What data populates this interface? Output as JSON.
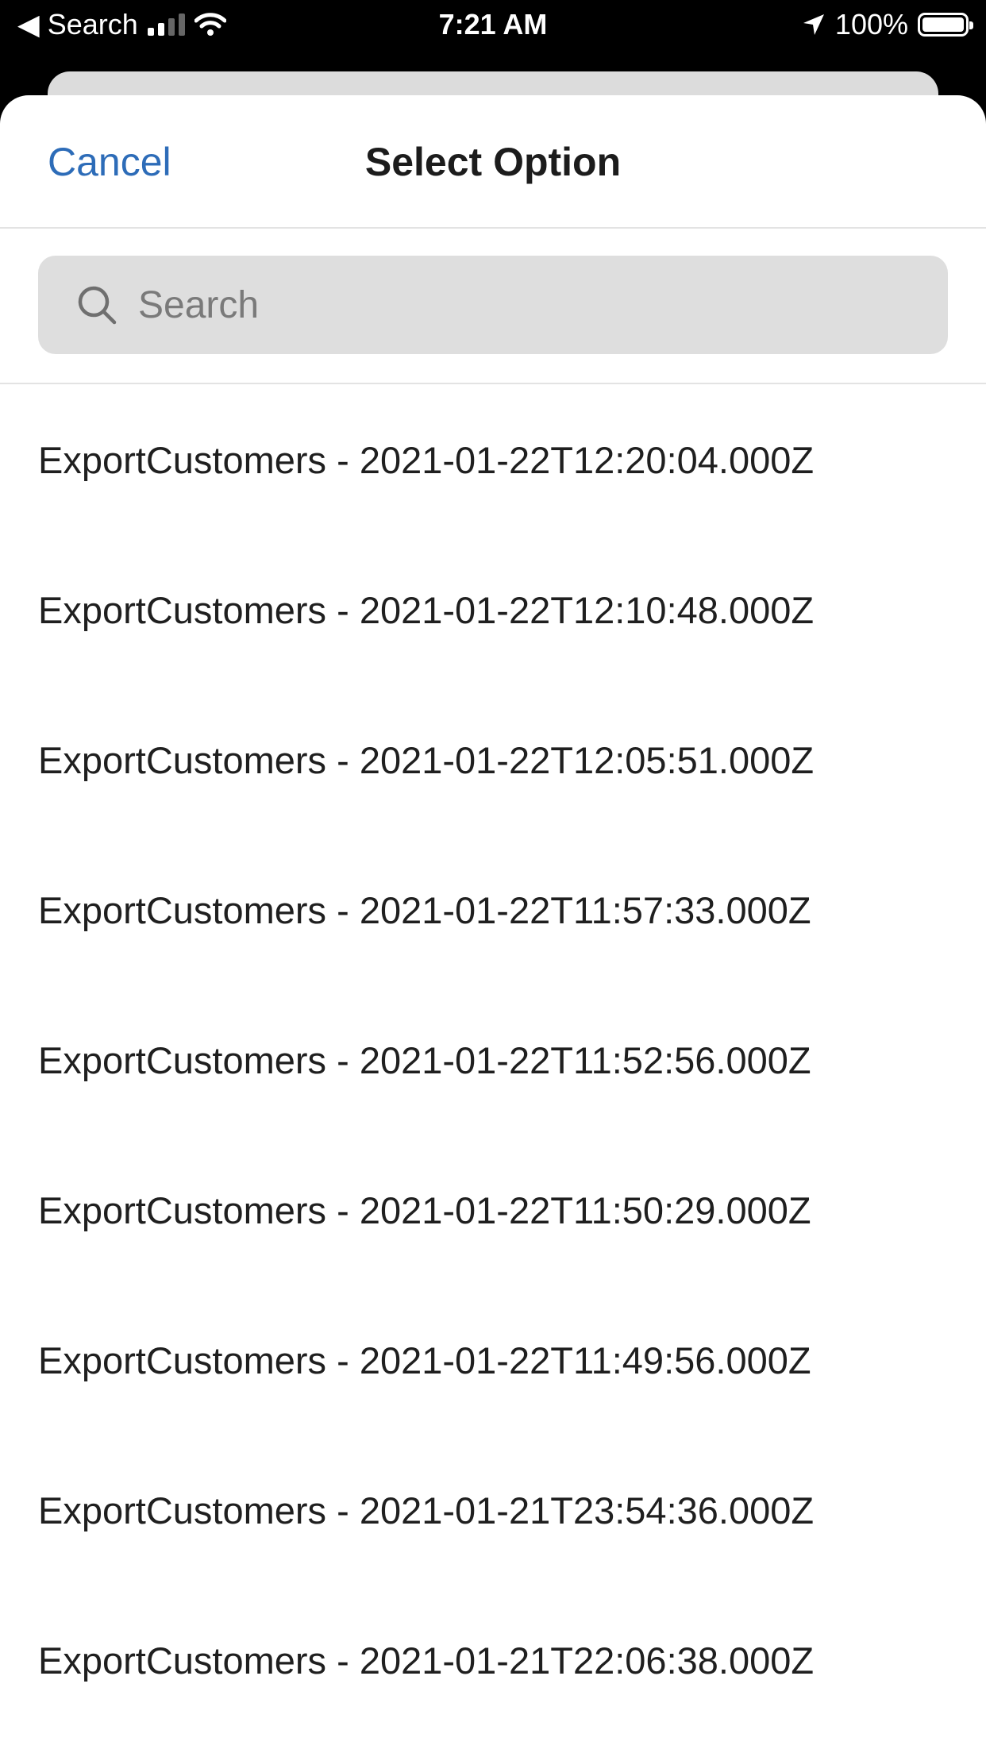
{
  "status_bar": {
    "back_label": "◀ Search",
    "time": "7:21 AM",
    "battery": "100%"
  },
  "sheet": {
    "cancel_label": "Cancel",
    "title": "Select Option"
  },
  "search": {
    "placeholder": "Search",
    "value": ""
  },
  "options": [
    "ExportCustomers - 2021-01-22T12:20:04.000Z",
    "ExportCustomers - 2021-01-22T12:10:48.000Z",
    "ExportCustomers - 2021-01-22T12:05:51.000Z",
    "ExportCustomers - 2021-01-22T11:57:33.000Z",
    "ExportCustomers - 2021-01-22T11:52:56.000Z",
    "ExportCustomers - 2021-01-22T11:50:29.000Z",
    "ExportCustomers - 2021-01-22T11:49:56.000Z",
    "ExportCustomers - 2021-01-21T23:54:36.000Z",
    "ExportCustomers - 2021-01-21T22:06:38.000Z"
  ],
  "colors": {
    "accent": "#2d6cb8",
    "search_bg": "#dedede"
  }
}
